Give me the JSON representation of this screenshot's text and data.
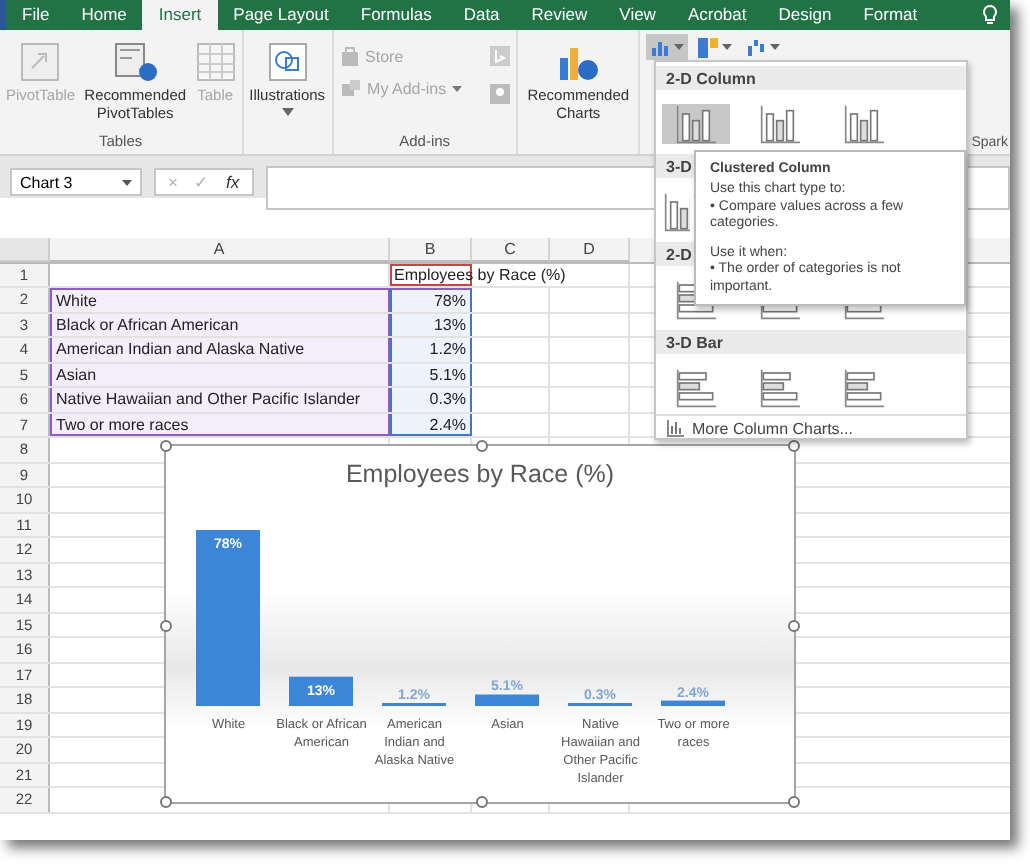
{
  "ribbon_tabs": [
    {
      "label": "File",
      "selected": false
    },
    {
      "label": "Home",
      "selected": false
    },
    {
      "label": "Insert",
      "selected": true
    },
    {
      "label": "Page Layout",
      "selected": false
    },
    {
      "label": "Formulas",
      "selected": false
    },
    {
      "label": "Data",
      "selected": false
    },
    {
      "label": "Review",
      "selected": false
    },
    {
      "label": "View",
      "selected": false
    },
    {
      "label": "Acrobat",
      "selected": false
    },
    {
      "label": "Design",
      "selected": false
    },
    {
      "label": "Format",
      "selected": false
    }
  ],
  "ribbon_groups": [
    {
      "label": "Tables",
      "kind": "large",
      "commands": [
        {
          "kind": "pivot",
          "label": "PivotTable",
          "disabled": true
        },
        {
          "kind": "recpivot",
          "label": "Recommended PivotTables",
          "disabled": false
        },
        {
          "kind": "table",
          "label": "Table",
          "disabled": true
        }
      ]
    },
    {
      "kind": "large",
      "commands": [
        {
          "kind": "illustrations",
          "label": "Illustrations",
          "disabled": false
        }
      ]
    },
    {
      "label": "Add-ins",
      "kind": "small",
      "commands": [
        {
          "kind": "store",
          "label": "Store",
          "disabled": true
        },
        {
          "kind": "addins",
          "label": "My Add-ins",
          "disabled": true
        }
      ]
    },
    {
      "kind": "large",
      "commands": [
        {
          "kind": "reccharts",
          "label": "Recommended Charts",
          "disabled": false
        }
      ]
    },
    {
      "kind": "charts",
      "commands": [
        {
          "kind": "column",
          "pressed": true
        },
        {
          "kind": "hierarchy",
          "pressed": false
        },
        {
          "kind": "waterfall",
          "pressed": false
        }
      ]
    },
    {
      "label": "Spark",
      "kind": "partial"
    }
  ],
  "formula_bar": {
    "name_box": "Chart 3",
    "buttons": [
      {
        "label": "×",
        "disabled": true
      },
      {
        "label": "✓",
        "disabled": true
      },
      {
        "label": "fx",
        "disabled": false
      }
    ]
  },
  "sheet": {
    "columns": [
      "A",
      "B",
      "C",
      "D"
    ],
    "rows": [
      {
        "number": "1",
        "b": "Employees by Race (%)",
        "name_range": true,
        "data_range": false
      },
      {
        "number": "2",
        "a": "White",
        "b": "78%",
        "name_range": false,
        "data_range": true
      },
      {
        "number": "3",
        "a": "Black or African American",
        "b": "13%",
        "name_range": false,
        "data_range": true
      },
      {
        "number": "4",
        "a": "American Indian and Alaska Native",
        "b": "1.2%",
        "name_range": false,
        "data_range": true
      },
      {
        "number": "5",
        "a": "Asian",
        "b": "5.1%",
        "name_range": false,
        "data_range": true
      },
      {
        "number": "6",
        "a": "Native Hawaiian and Other Pacific Islander",
        "b": "0.3%",
        "name_range": false,
        "data_range": true
      },
      {
        "number": "7",
        "a": "Two or more races",
        "b": "2.4%",
        "name_range": false,
        "data_range": true
      },
      {
        "number": "8"
      },
      {
        "number": "9"
      },
      {
        "number": "10"
      },
      {
        "number": "11"
      },
      {
        "number": "12"
      },
      {
        "number": "13"
      },
      {
        "number": "14"
      },
      {
        "number": "15"
      },
      {
        "number": "16"
      },
      {
        "number": "17"
      },
      {
        "number": "18"
      },
      {
        "number": "19"
      },
      {
        "number": "20"
      },
      {
        "number": "21"
      },
      {
        "number": "22"
      }
    ]
  },
  "chart": {
    "chart_data": {
      "type": "bar",
      "title": "Employees by Race (%)",
      "categories": [
        "White",
        "Black or African American",
        "American Indian and Alaska Native",
        "Asian",
        "Native Hawaiian and Other Pacific Islander",
        "Two or more races"
      ],
      "values": [
        78,
        13,
        1.2,
        5.1,
        0.3,
        2.4
      ],
      "value_labels": [
        "78%",
        "13%",
        "1.2%",
        "5.1%",
        "0.3%",
        "2.4%"
      ],
      "data_labels": true
    }
  },
  "dropdown": {
    "sections": [
      {
        "title": "2-D Column",
        "kind": "column",
        "items": [
          {
            "selected": true
          },
          {
            "selected": false
          },
          {
            "selected": false
          }
        ]
      },
      {
        "title": "3-D",
        "kind": "column3d",
        "items": [
          {
            "selected": false
          }
        ]
      },
      {
        "title": "2-D",
        "kind": "bar",
        "items": [
          {
            "selected": false
          },
          {
            "selected": false
          },
          {
            "selected": false
          }
        ]
      },
      {
        "title": "3-D Bar",
        "kind": "bar3d",
        "items": [
          {
            "selected": false
          },
          {
            "selected": false
          },
          {
            "selected": false
          }
        ]
      }
    ],
    "more_link": "More Column Charts..."
  },
  "tooltip": {
    "title": "Clustered Column",
    "paragraphs": [
      {
        "heading": "Use this chart type to:",
        "bullet": "• Compare values across a few categories."
      },
      {
        "heading": "Use it when:",
        "bullet": "• The order of categories is not important."
      }
    ]
  }
}
